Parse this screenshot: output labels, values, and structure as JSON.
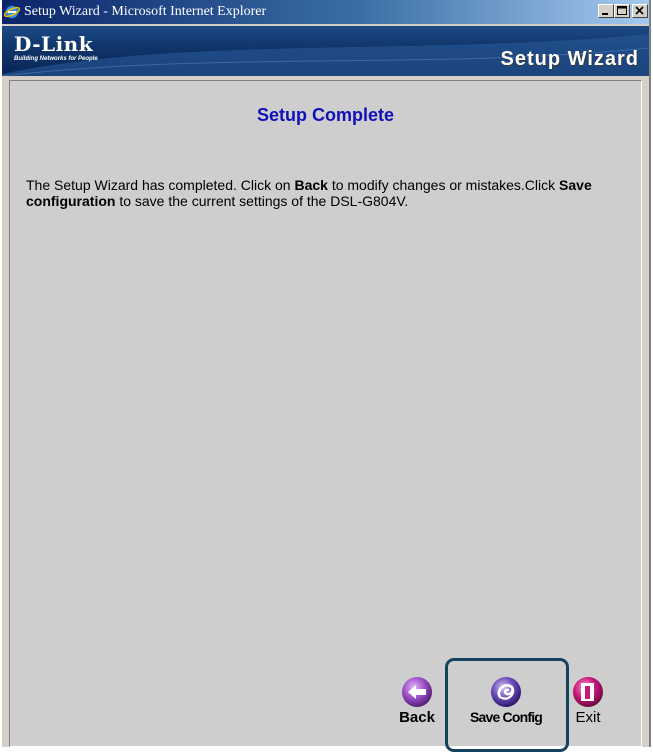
{
  "window": {
    "title": "Setup Wizard - Microsoft Internet Explorer"
  },
  "banner": {
    "brand": "D-Link",
    "tagline": "Building Networks for People",
    "title": "Setup Wizard"
  },
  "page": {
    "heading": "Setup Complete",
    "text_1": "The Setup Wizard has completed. Click on ",
    "bold_1": "Back",
    "text_2": " to modify changes or mistakes.Click ",
    "bold_2": "Save configuration",
    "text_3": " to save the current settings of the DSL-G804V."
  },
  "buttons": {
    "back": "Back",
    "save": "Save Config",
    "exit": "Exit"
  },
  "colors": {
    "heading": "#1010b8",
    "content_bg": "#cecece",
    "back_icon": "#9b4fc6",
    "save_icon": "#6a4ab8",
    "exit_icon": "#c8167a",
    "highlight_border": "#15425e"
  },
  "icons": {
    "back": "arrow-left-icon",
    "save": "swirl-icon",
    "exit": "exit-door-icon"
  }
}
